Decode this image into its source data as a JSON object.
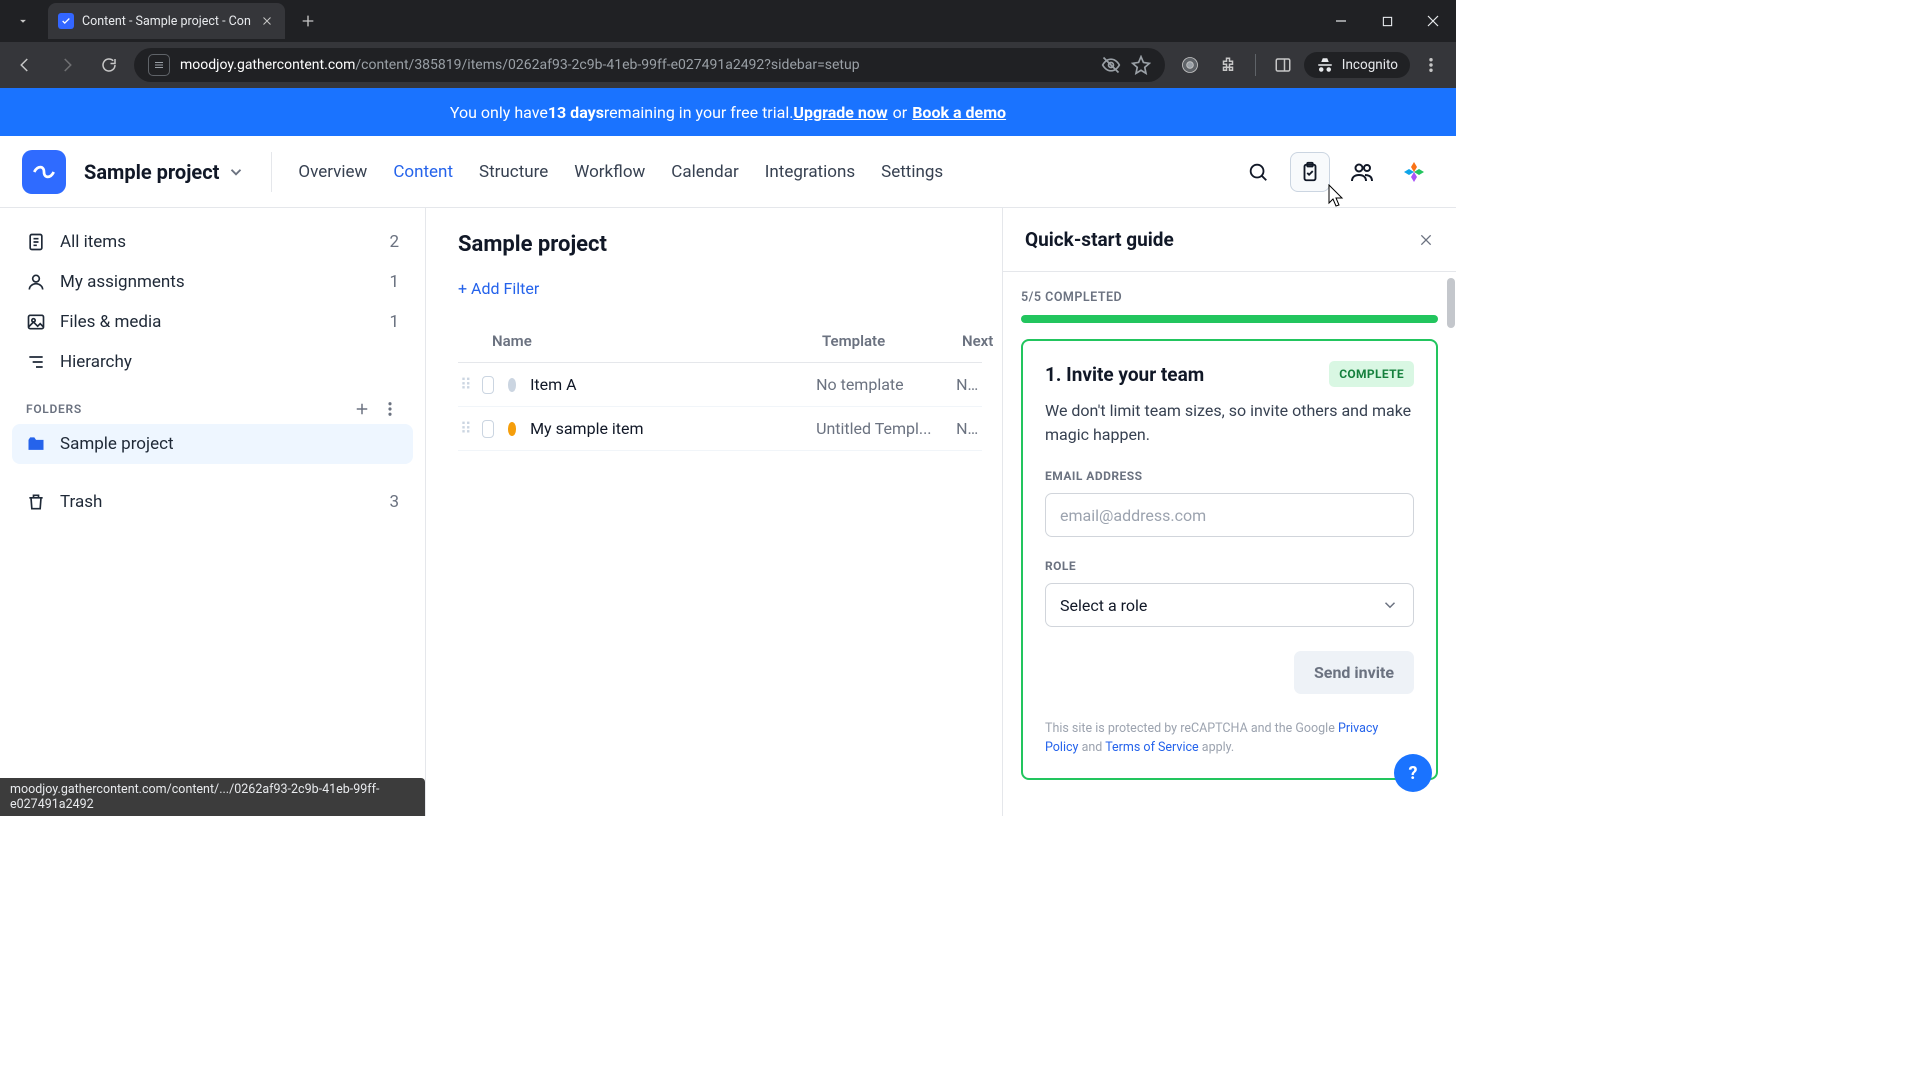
{
  "browser": {
    "tab_title": "Content - Sample project - Con",
    "url_host": "moodjoy.gathercontent.com",
    "url_path": "/content/385819/items/0262af93-2c9b-41eb-99ff-e027491a2492?sidebar=setup",
    "incognito_label": "Incognito",
    "status_bar": "moodjoy.gathercontent.com/content/.../0262af93-2c9b-41eb-99ff-e027491a2492"
  },
  "banner": {
    "prefix": "You only have ",
    "days": "13 days",
    "middle": " remaining in your free trial. ",
    "upgrade": "Upgrade now",
    "or": " or ",
    "book": "Book a demo"
  },
  "header": {
    "project_name": "Sample project",
    "nav": [
      "Overview",
      "Content",
      "Structure",
      "Workflow",
      "Calendar",
      "Integrations",
      "Settings"
    ],
    "active_nav": "Content"
  },
  "sidebar": {
    "items": [
      {
        "label": "All items",
        "count": "2"
      },
      {
        "label": "My assignments",
        "count": "1"
      },
      {
        "label": "Files & media",
        "count": "1"
      },
      {
        "label": "Hierarchy",
        "count": ""
      }
    ],
    "folders_label": "FOLDERS",
    "folders": [
      {
        "label": "Sample project"
      }
    ],
    "trash": {
      "label": "Trash",
      "count": "3"
    }
  },
  "main": {
    "title": "Sample project",
    "add_filter": "+ Add Filter",
    "columns": {
      "name": "Name",
      "template": "Template",
      "next": "Next"
    },
    "rows": [
      {
        "name": "Item A",
        "template": "No template",
        "next": "No du",
        "dot": "#cbd5e1"
      },
      {
        "name": "My sample item",
        "template": "Untitled Templ...",
        "next": "No du",
        "dot": "#f59e0b"
      }
    ]
  },
  "panel": {
    "title": "Quick-start guide",
    "progress": "5/5 COMPLETED",
    "card_title": "1. Invite your team",
    "badge": "COMPLETE",
    "card_body": "We don't limit team sizes, so invite others and make magic happen.",
    "email_label": "EMAIL ADDRESS",
    "email_placeholder": "email@address.com",
    "role_label": "ROLE",
    "role_value": "Select a role",
    "send_label": "Send invite",
    "legal_prefix": "This site is protected by reCAPTCHA and the Google ",
    "privacy": "Privacy Policy",
    "and": " and ",
    "tos": "Terms of Service",
    "apply": " apply."
  },
  "help": "?"
}
